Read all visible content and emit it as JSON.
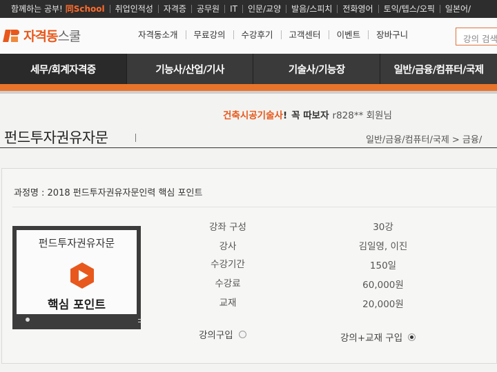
{
  "topbar": {
    "items": [
      "함께하는 공부!",
      "취업인적성",
      "자격증",
      "공무원",
      "IT",
      "인문/교양",
      "발음/스피치",
      "전화영어",
      "토익/텝스/오픽",
      "일본어/"
    ],
    "brand": "同School"
  },
  "header": {
    "logo_text_1": "자격동",
    "logo_text_2": "스쿨",
    "nav": [
      "자격동소개",
      "무료강의",
      "수강후기",
      "고객센터",
      "이벤트",
      "장바구니"
    ],
    "search_placeholder": "강의 검색"
  },
  "categories": [
    "세무/회계자격증",
    "기능사/산업/기사",
    "기술사/기능장",
    "일반/금융/컴퓨터/국제"
  ],
  "welcome": {
    "course": "건축시공기술사",
    "excl": "!",
    "greeting": "꼭 따보자",
    "user": "r828** 회원님"
  },
  "page": {
    "title": "펀드투자권유자문",
    "breadcrumb": "일반/금융/컴퓨터/국제 > 금융/"
  },
  "course": {
    "name_line": "과정명 : 2018 펀드투자권유자문인력 핵심 포인트",
    "thumb_title": "펀드투자권유자문",
    "thumb_subtitle": "핵심 포인트",
    "info": [
      {
        "label": "강좌 구성",
        "value": "30강"
      },
      {
        "label": "강사",
        "value": "김일영, 이진"
      },
      {
        "label": "수강기간",
        "value": "150일"
      },
      {
        "label": "수강료",
        "value": "60,000원"
      },
      {
        "label": "교재",
        "value": "20,000원"
      }
    ],
    "options": [
      {
        "label": "강의구입",
        "checked": false
      },
      {
        "label": "강의+교재 구입",
        "checked": true
      }
    ]
  },
  "colors": {
    "accent": "#e8581c",
    "nav_bg": "#3a3a3a",
    "orange_bar": "#e8742a",
    "topbar_bg": "#2d2d2d"
  }
}
